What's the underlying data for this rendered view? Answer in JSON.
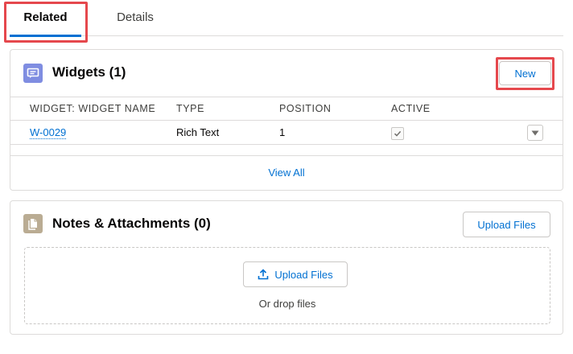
{
  "tabs": [
    {
      "label": "Related",
      "active": true
    },
    {
      "label": "Details",
      "active": false
    }
  ],
  "widgets_card": {
    "title": "Widgets (1)",
    "new_button": "New",
    "columns": [
      "WIDGET: WIDGET NAME",
      "TYPE",
      "POSITION",
      "ACTIVE"
    ],
    "rows": [
      {
        "name": "W-0029",
        "type": "Rich Text",
        "position": "1",
        "active": true
      }
    ],
    "view_all": "View All",
    "icon": "widget-icon"
  },
  "notes_card": {
    "title": "Notes & Attachments (0)",
    "upload_button": "Upload Files",
    "drop_upload_button": "Upload Files",
    "drop_text": "Or drop files",
    "icon": "attachment-icon"
  },
  "colors": {
    "accent": "#0070d2",
    "highlight": "#e5484d",
    "widget_icon_bg": "#7f8de1",
    "notes_icon_bg": "#baac93"
  }
}
